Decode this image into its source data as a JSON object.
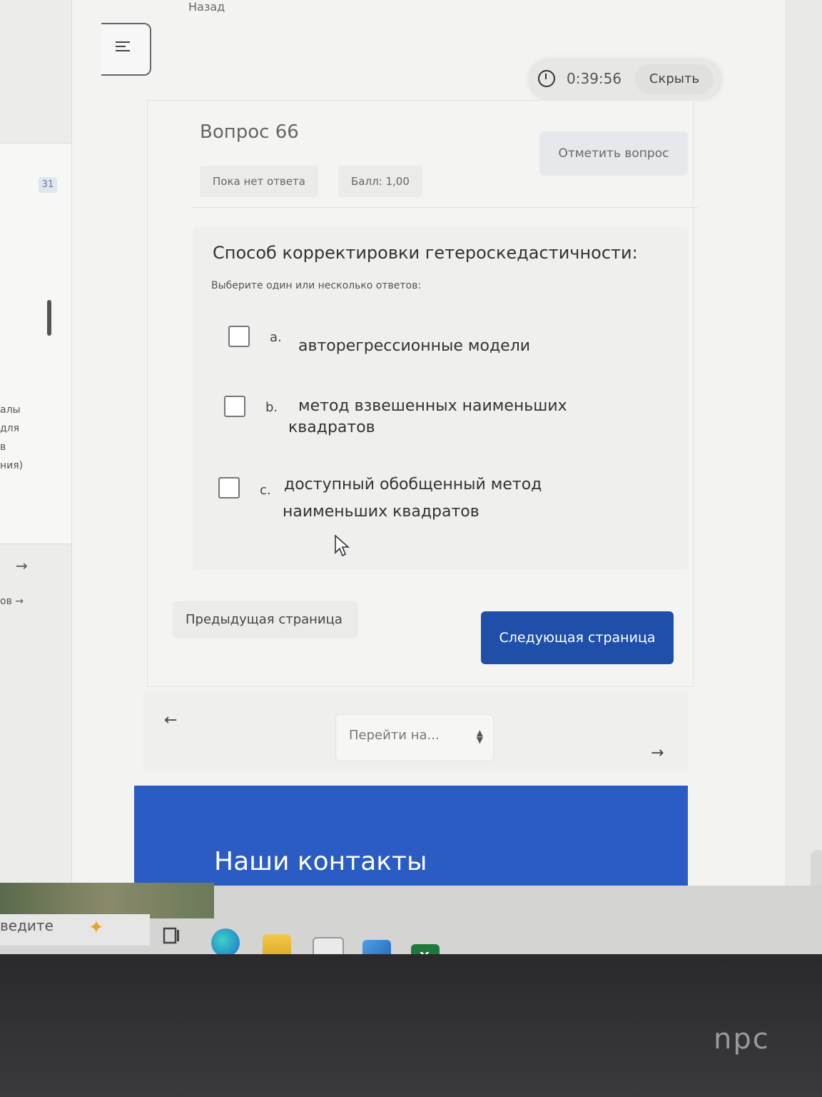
{
  "header": {
    "back_label": "Назад",
    "timer_value": "0:39:56",
    "hide_label": "Скрыть"
  },
  "sidebar": {
    "badge": "31",
    "fragments": [
      "алы",
      "для",
      "в",
      "ния)"
    ],
    "link_fragment": "ов"
  },
  "question": {
    "title": "Вопрос 66",
    "flag_label": "Отметить вопрос",
    "status": "Пока нет ответа",
    "score": "Балл: 1,00",
    "text": "Способ корректировки гетероскедастичности:",
    "hint": "Выберите один или несколько ответов:",
    "options": [
      {
        "letter": "a.",
        "text": "авторегрессионные модели"
      },
      {
        "letter": "b.",
        "line1": "метод взвешенных наименьших",
        "line2": "квадратов"
      },
      {
        "letter": "c.",
        "line1": "доступный обобщенный метод",
        "line2": "наименьших квадратов"
      }
    ]
  },
  "navigation": {
    "prev_label": "Предыдущая страница",
    "next_label": "Следующая страница",
    "jump_placeholder": "Перейти на..."
  },
  "footer": {
    "title": "Наши контакты"
  },
  "taskbar": {
    "search_text": "ведите",
    "apps": [
      "task-view",
      "edge",
      "file-explorer",
      "store",
      "mail",
      "excel"
    ]
  },
  "monitor": {
    "brand": "npc"
  },
  "colors": {
    "primary": "#1f4fa8",
    "footer": "#2a5cc4"
  }
}
